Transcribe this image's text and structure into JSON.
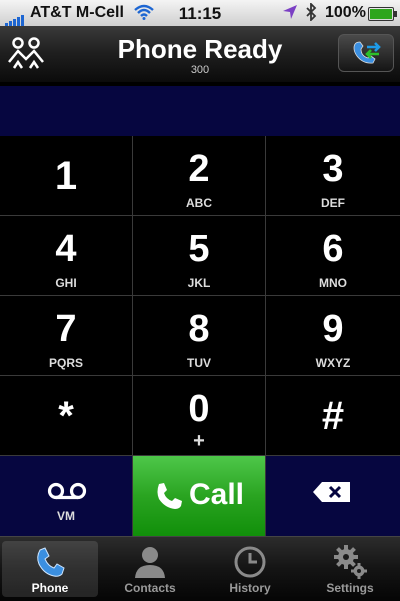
{
  "status_bar": {
    "carrier": "AT&T M-Cell",
    "time": "11:15",
    "battery_percent": "100%",
    "icons": [
      "signal-icon",
      "wifi-icon",
      "location-icon",
      "bluetooth-icon",
      "battery-icon"
    ]
  },
  "header": {
    "title": "Phone Ready",
    "subtitle": "300",
    "left_button_icon": "conference-icon",
    "right_button_icon": "transfer-call-icon"
  },
  "display": {
    "number": ""
  },
  "keypad": {
    "keys": [
      {
        "digit": "1",
        "letters": ""
      },
      {
        "digit": "2",
        "letters": "ABC"
      },
      {
        "digit": "3",
        "letters": "DEF"
      },
      {
        "digit": "4",
        "letters": "GHI"
      },
      {
        "digit": "5",
        "letters": "JKL"
      },
      {
        "digit": "6",
        "letters": "MNO"
      },
      {
        "digit": "7",
        "letters": "PQRS"
      },
      {
        "digit": "8",
        "letters": "TUV"
      },
      {
        "digit": "9",
        "letters": "WXYZ"
      },
      {
        "digit": "*",
        "letters": ""
      },
      {
        "digit": "0",
        "letters": "+"
      },
      {
        "digit": "#",
        "letters": ""
      }
    ],
    "voicemail_label": "VM",
    "call_label": "Call",
    "delete_icon": "backspace-icon"
  },
  "tabs": [
    {
      "label": "Phone",
      "icon": "phone-icon",
      "active": true
    },
    {
      "label": "Contacts",
      "icon": "contacts-icon",
      "active": false
    },
    {
      "label": "History",
      "icon": "clock-icon",
      "active": false
    },
    {
      "label": "Settings",
      "icon": "gears-icon",
      "active": false
    }
  ],
  "colors": {
    "display_background": "#060640",
    "call_button": "#2aa421",
    "tab_active_icon": "#3b8fe0"
  }
}
